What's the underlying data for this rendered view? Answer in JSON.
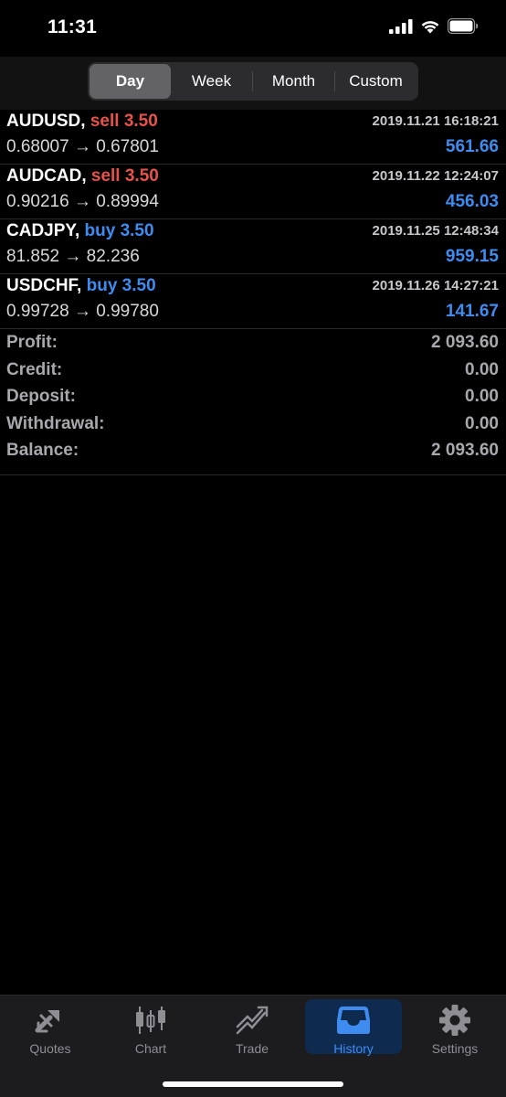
{
  "status_bar": {
    "time": "11:31"
  },
  "segments": [
    {
      "label": "Day",
      "active": true
    },
    {
      "label": "Week",
      "active": false
    },
    {
      "label": "Month",
      "active": false
    },
    {
      "label": "Custom",
      "active": false
    }
  ],
  "trades": [
    {
      "symbol": "AUDUSD,",
      "side": "sell",
      "side_label": "sell 3.50",
      "time": "2019.11.21 16:18:21",
      "prices": "0.68007 → 0.67801",
      "profit": "561.66"
    },
    {
      "symbol": "AUDCAD,",
      "side": "sell",
      "side_label": "sell 3.50",
      "time": "2019.11.22 12:24:07",
      "prices": "0.90216 → 0.89994",
      "profit": "456.03"
    },
    {
      "symbol": "CADJPY,",
      "side": "buy",
      "side_label": "buy 3.50",
      "time": "2019.11.25 12:48:34",
      "prices": "81.852 → 82.236",
      "profit": "959.15"
    },
    {
      "symbol": "USDCHF,",
      "side": "buy",
      "side_label": "buy 3.50",
      "time": "2019.11.26 14:27:21",
      "prices": "0.99728 → 0.99780",
      "profit": "141.67"
    }
  ],
  "summary": [
    {
      "label": "Profit:",
      "value": "2 093.60"
    },
    {
      "label": "Credit:",
      "value": "0.00"
    },
    {
      "label": "Deposit:",
      "value": "0.00"
    },
    {
      "label": "Withdrawal:",
      "value": "0.00"
    },
    {
      "label": "Balance:",
      "value": "2 093.60"
    }
  ],
  "tabs": [
    {
      "label": "Quotes",
      "icon": "quotes-icon",
      "active": false
    },
    {
      "label": "Chart",
      "icon": "chart-icon",
      "active": false
    },
    {
      "label": "Trade",
      "icon": "trade-icon",
      "active": false
    },
    {
      "label": "History",
      "icon": "history-icon",
      "active": true
    },
    {
      "label": "Settings",
      "icon": "settings-icon",
      "active": false
    }
  ],
  "colors": {
    "sell": "#e8524a",
    "buy": "#3f8cf0",
    "profit": "#3f8cf0",
    "active_tab": "#3f8cf0"
  }
}
